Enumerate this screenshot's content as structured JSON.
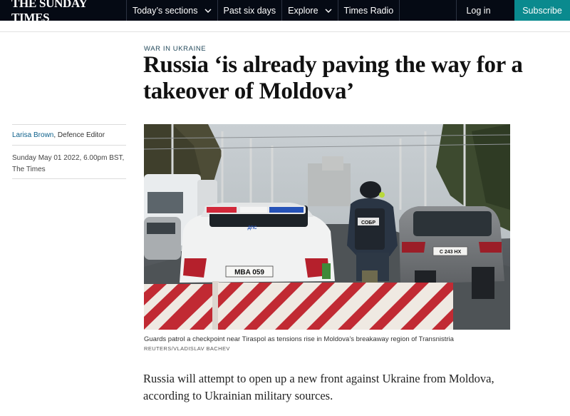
{
  "nav": {
    "logo": "THE SUNDAY TIMES",
    "items": [
      {
        "label": "Today’s sections",
        "dropdown": true
      },
      {
        "label": "Past six days",
        "dropdown": false
      },
      {
        "label": "Explore",
        "dropdown": true
      },
      {
        "label": "Times Radio",
        "dropdown": false
      }
    ],
    "login_label": "Log in",
    "subscribe_label": "Subscribe",
    "colors": {
      "bar": "#050a14",
      "subscribe": "#0a8a8e"
    }
  },
  "article": {
    "section": "War in Ukraine",
    "headline": "Russia ‘is already paving the way for a takeover of Moldova’",
    "author": "Larisa Brown",
    "author_role": ", Defence Editor",
    "date": "Sunday May 01 2022, 6.00pm BST,",
    "publication": "The Times",
    "image": {
      "caption": "Guards patrol a checkpoint near Tiraspol as tensions rise in Moldova’s breakaway region of Transnistria",
      "credit": "Reuters/Vladislav Bachev",
      "plate": "MBA 059",
      "rear_plate": "C 243 HX",
      "vest_text": "СОБР",
      "lightbar_text": "ДПС"
    },
    "lede": "Russia will attempt to open up a new front against Ukraine from Moldova, according to Ukrainian military sources."
  }
}
